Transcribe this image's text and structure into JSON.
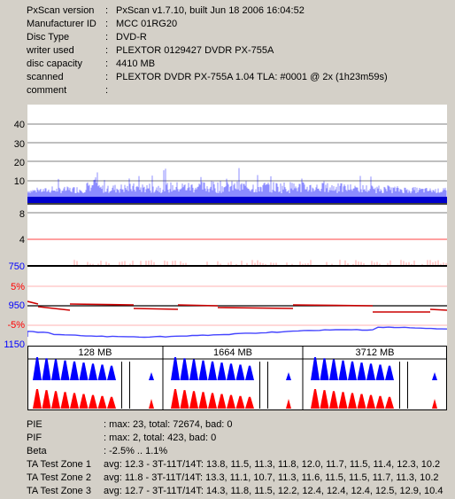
{
  "info": [
    {
      "label": "PxScan version",
      "value": "PxScan v1.7.10, built Jun 18 2006 16:04:52"
    },
    {
      "label": "Manufacturer ID",
      "value": "MCC 01RG20"
    },
    {
      "label": "Disc Type",
      "value": "DVD-R"
    },
    {
      "label": "writer used",
      "value": "PLEXTOR 0129427 DVDR PX-755A"
    },
    {
      "label": "disc capacity",
      "value": "4410 MB"
    },
    {
      "label": "scanned",
      "value": "PLEXTOR DVDR PX-755A 1.04 TLA: #0001 @ 2x (1h23m59s)"
    },
    {
      "label": "comment",
      "value": ""
    }
  ],
  "colon": ":",
  "axis_labels": {
    "pie": [
      "40",
      "30",
      "20",
      "10"
    ],
    "pif": [
      "8",
      "4"
    ],
    "jitter_top": "750",
    "beta_pos": "5%",
    "jitter_mid": "950",
    "beta_neg": "-5%",
    "jitter_bottom": "1150"
  },
  "zones": [
    "128 MB",
    "1664 MB",
    "3712 MB"
  ],
  "stats": [
    {
      "label": "PIE",
      "value": ": max: 23, total: 72674, bad: 0"
    },
    {
      "label": "PIF",
      "value": ": max: 2, total: 423, bad: 0"
    },
    {
      "label": "Beta",
      "value": ": -2.5% .. 1.1%"
    },
    {
      "label": "TA Test Zone 1",
      "value": "avg: 12.3 - 3T-11T/14T: 13.8, 11.5, 11.3, 11.8, 12.0, 11.7, 11.5, 11.4, 12.3, 10.2"
    },
    {
      "label": "TA Test Zone 2",
      "value": "avg: 11.8 - 3T-11T/14T: 13.3, 11.1, 10.7, 11.3, 11.6, 11.5, 11.5, 11.7, 11.3, 10.2"
    },
    {
      "label": "TA Test Zone 3",
      "value": "avg: 12.7 - 3T-11T/14T: 14.3, 11.8, 11.5, 12.2, 12.4, 12.4, 12.4, 12.5, 12.9, 10.4"
    }
  ],
  "colors": {
    "pie": "#0000ff",
    "pif": "#ff0000",
    "beta": "#cc0000",
    "jitter": "#4444ff",
    "axis_red": "#ff0000",
    "axis_blue": "#0000ff"
  }
}
